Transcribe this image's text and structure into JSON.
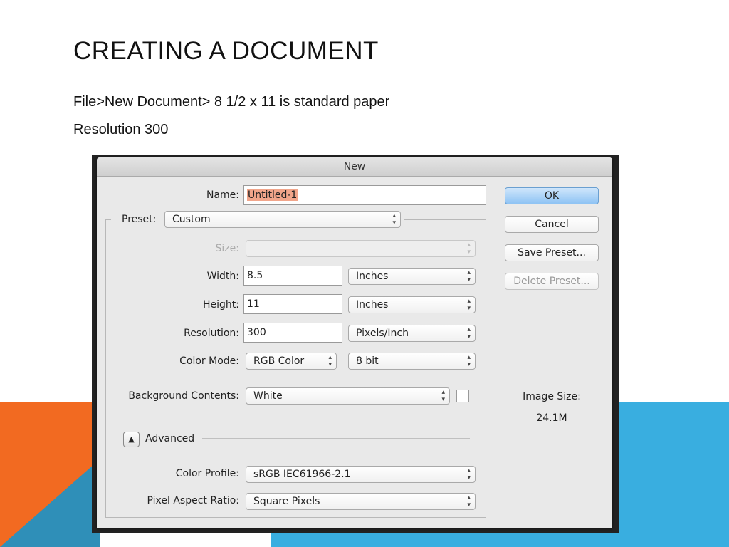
{
  "slide": {
    "title": "CREATING A DOCUMENT",
    "bullets": [
      "File>New Document> 8 1/2 x 11 is standard paper",
      "Resolution 300"
    ],
    "colors": {
      "orange": "#f26a21",
      "blue": "#39aee0",
      "blue_dark": "#2f8fb8"
    }
  },
  "dialog": {
    "title": "New",
    "name_label": "Name:",
    "name_value": "Untitled-1",
    "preset_label": "Preset:",
    "preset_value": "Custom",
    "size_label": "Size:",
    "size_value": "",
    "width_label": "Width:",
    "width_value": "8.5",
    "width_unit": "Inches",
    "height_label": "Height:",
    "height_value": "11",
    "height_unit": "Inches",
    "resolution_label": "Resolution:",
    "resolution_value": "300",
    "resolution_unit": "Pixels/Inch",
    "color_mode_label": "Color Mode:",
    "color_mode_value": "RGB Color",
    "bit_depth_value": "8 bit",
    "background_label": "Background Contents:",
    "background_value": "White",
    "advanced_label": "Advanced",
    "color_profile_label": "Color Profile:",
    "color_profile_value": "sRGB IEC61966-2.1",
    "pixel_aspect_label": "Pixel Aspect Ratio:",
    "pixel_aspect_value": "Square Pixels",
    "buttons": {
      "ok": "OK",
      "cancel": "Cancel",
      "save_preset": "Save Preset...",
      "delete_preset": "Delete Preset..."
    },
    "image_size_label": "Image Size:",
    "image_size_value": "24.1M",
    "icons": {
      "stepper": "up-down-arrows-icon",
      "advanced_toggle": "triangle-up-icon"
    }
  }
}
